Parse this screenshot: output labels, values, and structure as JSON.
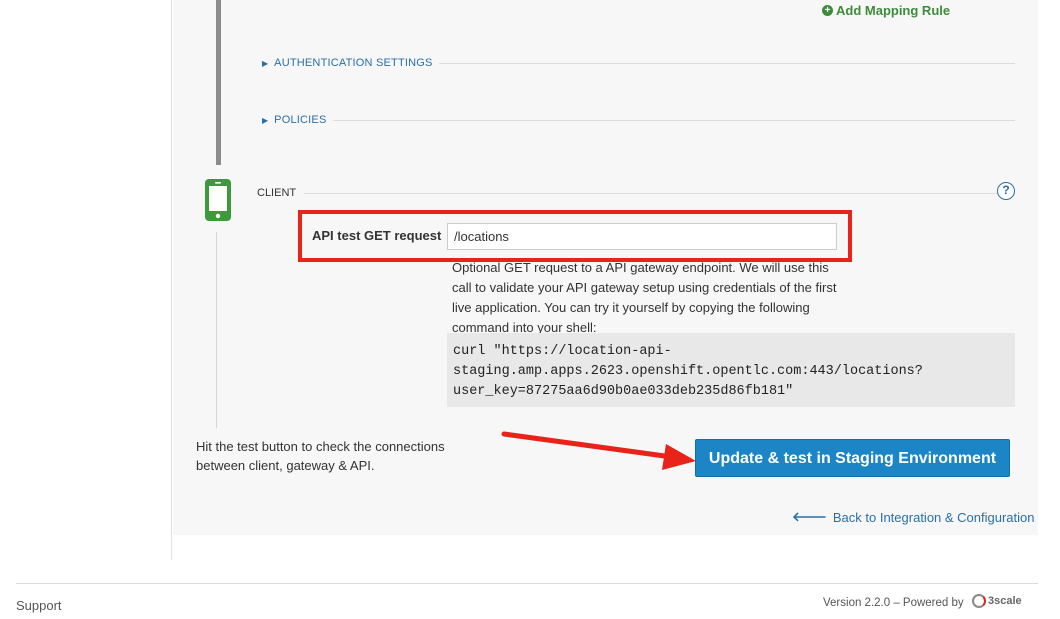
{
  "mapping": {
    "add_label": "Add Mapping Rule"
  },
  "sections": {
    "authentication": "AUTHENTICATION SETTINGS",
    "policies": "POLICIES",
    "client": "CLIENT"
  },
  "client": {
    "field_label": "API test GET request",
    "field_value": "/locations",
    "help_text": "Optional GET request to a API gateway endpoint. We will use this call to validate your API gateway setup using credentials of the first live application. You can try it yourself by copying the following command into your shell:",
    "command": "curl \"https://location-api-\nstaging.amp.apps.2623.openshift.opentlc.com:443/locations?\nuser_key=87275aa6d90b0ae033deb235d86fb181\"",
    "help_icon": "?"
  },
  "test": {
    "hint": "Hit the test button to check the connections between client, gateway & API.",
    "button_label": "Update & test in Staging Environment"
  },
  "navigation": {
    "back_label": "Back to Integration & Configuration"
  },
  "footer": {
    "support_label": "Support",
    "version_text": "Version 2.2.0 – Powered by",
    "logo_text": "3scale"
  },
  "colors": {
    "accent": "#1b85c6",
    "annotation_red": "#e8231a",
    "success_green": "#3c8c3c",
    "link_blue": "#2a6fa8"
  }
}
